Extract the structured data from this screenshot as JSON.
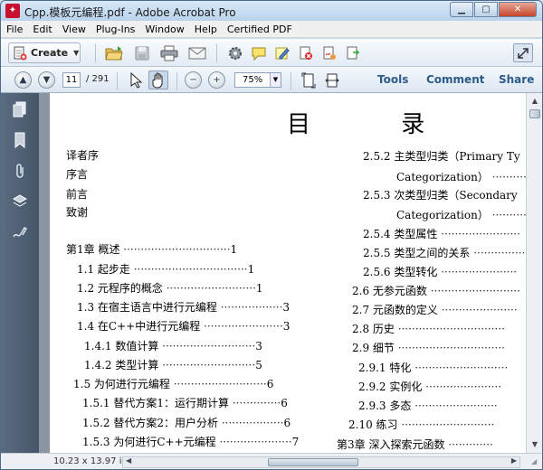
{
  "window": {
    "title": "Cpp.模板元编程.pdf - Adobe Acrobat Pro"
  },
  "menu": [
    "File",
    "Edit",
    "View",
    "Plug-Ins",
    "Window",
    "Help",
    "Certified PDF"
  ],
  "toolbar": {
    "create_label": "Create"
  },
  "nav": {
    "page_current": "11",
    "page_total": "/ 291",
    "zoom": "75%"
  },
  "panels": {
    "tools": "Tools",
    "comment": "Comment",
    "share": "Share"
  },
  "status": {
    "page_size": "10.23 x 13.97 in"
  },
  "page": {
    "heading": "目 录",
    "left_col": [
      {
        "label": "译者序",
        "dots": "",
        "page": ""
      },
      {
        "label": "序言",
        "dots": "",
        "page": ""
      },
      {
        "label": "前言",
        "dots": "",
        "page": ""
      },
      {
        "label": "致谢",
        "dots": "",
        "page": ""
      },
      {
        "label": "第1章   概述",
        "dots": "·······························",
        "page": "1"
      },
      {
        "label": "1.1   起步走",
        "dots": "·································",
        "page": "1"
      },
      {
        "label": "1.2   元程序的概念",
        "dots": "··························",
        "page": "1"
      },
      {
        "label": "1.3   在宿主语言中进行元编程",
        "dots": "··················",
        "page": "3"
      },
      {
        "label": "1.4   在C++中进行元编程",
        "dots": "·······················",
        "page": "3"
      },
      {
        "label": "1.4.1   数值计算",
        "dots": "···························",
        "page": "3"
      },
      {
        "label": "1.4.2   类型计算",
        "dots": "···························",
        "page": "5"
      },
      {
        "label": "1.5   为何进行元编程",
        "dots": "···························",
        "page": "6"
      },
      {
        "label": "1.5.1   替代方案1：运行期计算",
        "dots": "··············",
        "page": "6"
      },
      {
        "label": "1.5.2   替代方案2：用户分析",
        "dots": "··················",
        "page": "6"
      },
      {
        "label": "1.5.3   为何进行C++元编程",
        "dots": "·····················",
        "page": "7"
      }
    ],
    "right_col": [
      {
        "label": "2.5.2   主类型归类（Primary Ty",
        "dots": ""
      },
      {
        "label": "Categorization）",
        "dots": "···············"
      },
      {
        "label": "2.5.3   次类型归类（Secondary",
        "dots": ""
      },
      {
        "label": "Categorization）",
        "dots": "···············"
      },
      {
        "label": "2.5.4   类型属性",
        "dots": "·······················"
      },
      {
        "label": "2.5.5   类型之间的关系",
        "dots": "················"
      },
      {
        "label": "2.5.6   类型转化",
        "dots": "······················"
      },
      {
        "label": "2.6   无参元函数",
        "dots": "··························"
      },
      {
        "label": "2.7   元函数的定义",
        "dots": "······················"
      },
      {
        "label": "2.8   历史",
        "dots": "·······························"
      },
      {
        "label": "2.9   细节",
        "dots": "·······························"
      },
      {
        "label": "2.9.1   特化",
        "dots": "···························"
      },
      {
        "label": "2.9.2   实例化",
        "dots": "······················"
      },
      {
        "label": "2.9.3   多态",
        "dots": "························"
      },
      {
        "label": "2.10   练习",
        "dots": "···························"
      },
      {
        "label": "第3章   深入探索元函数",
        "dots": "·············"
      }
    ]
  }
}
